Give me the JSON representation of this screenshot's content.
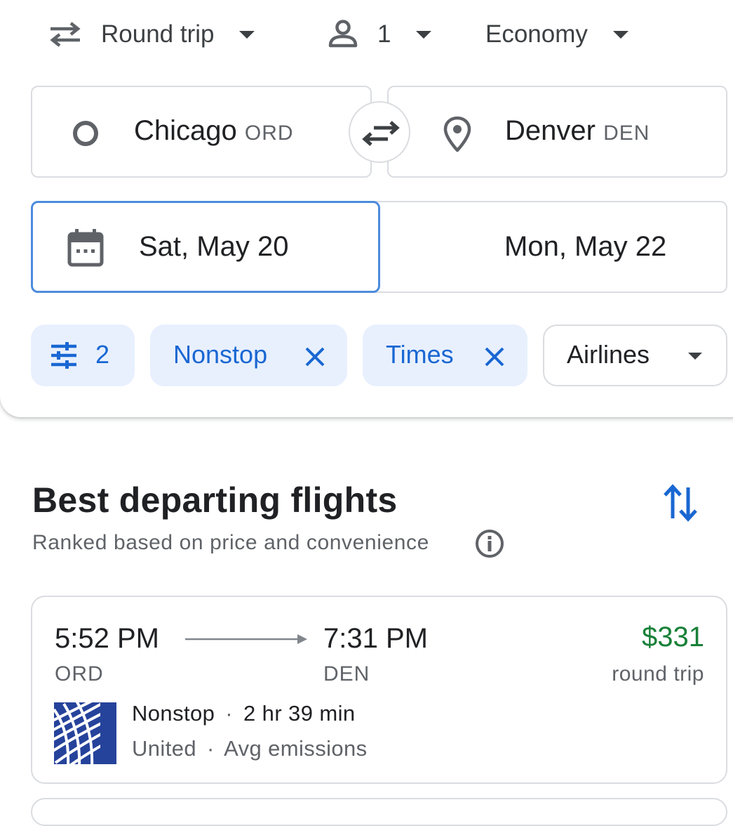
{
  "trip_options": {
    "trip_type": "Round trip",
    "passengers": "1",
    "cabin_class": "Economy"
  },
  "route": {
    "origin_city": "Chicago",
    "origin_code": "ORD",
    "destination_city": "Denver",
    "destination_code": "DEN"
  },
  "dates": {
    "depart": "Sat, May 20",
    "return": "Mon, May 22"
  },
  "filters": {
    "all_filters_count": "2",
    "chips": [
      {
        "label": "Nonstop",
        "removable": true
      },
      {
        "label": "Times",
        "removable": true
      },
      {
        "label": "Airlines",
        "removable": false
      }
    ]
  },
  "results": {
    "title": "Best departing flights",
    "subtitle": "Ranked based on price and convenience",
    "flights": [
      {
        "depart_time": "5:52 PM",
        "depart_code": "ORD",
        "arrive_time": "7:31 PM",
        "arrive_code": "DEN",
        "price": "$331",
        "price_note": "round trip",
        "stops": "Nonstop",
        "duration": "2 hr 39 min",
        "airline": "United",
        "emissions": "Avg emissions",
        "separator": "·"
      }
    ]
  },
  "colors": {
    "accent_blue": "#1967d2",
    "chip_bg": "#e8f0fe",
    "price_green": "#188038",
    "focus_border": "#4c8bdc",
    "border": "#dadce0",
    "icon_gray": "#5f6368",
    "united_blue": "#26439b"
  },
  "icons": {
    "trip_type": "swap-horiz-icon",
    "passengers": "person-icon",
    "origin": "circle-origin-icon",
    "swap": "swap-places-icon",
    "destination": "location-pin-icon",
    "calendar": "calendar-icon",
    "filters": "tune-icon",
    "remove": "close-icon",
    "dropdown": "caret-down-icon",
    "sort": "sort-icon",
    "info": "info-icon",
    "airline": "united-logo"
  }
}
